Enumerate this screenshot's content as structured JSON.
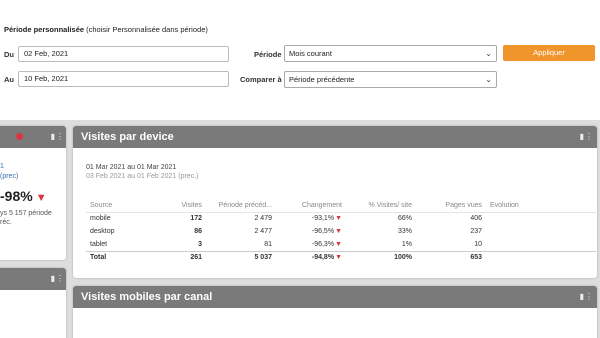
{
  "filter": {
    "title_bold": "Période personnalisée",
    "title_hint": " (choisir Personnalisée dans période)",
    "du_label": "Du",
    "du_value": "02 Feb, 2021",
    "au_label": "Au",
    "au_value": "10 Feb, 2021",
    "periode_label": "Période",
    "periode_value": "Mois courant",
    "comparer_label": "Comparer à",
    "comparer_value": "Période précédente",
    "apply_label": "Appliquer"
  },
  "left_widget": {
    "link1": "1",
    "link2": "(prec)",
    "big_value": "-98%",
    "text1": "ys 5 157 période",
    "text2": "réc."
  },
  "device_widget": {
    "title": "Visites par device",
    "current_period": "01 Mar 2021 au  01 Mar 2021",
    "previous_period": "03 Feb 2021 au  01 Feb 2021 (prec.)",
    "columns": [
      "Source",
      "Visites",
      "Période précéd...",
      "Changement",
      "% Visites/ site",
      "Pages vues",
      "Evolution"
    ],
    "rows": [
      {
        "source": "mobile",
        "visites": "172",
        "prev": "2 479",
        "change": "-93,1%",
        "pct": "66%",
        "pages": "406"
      },
      {
        "source": "desktop",
        "visites": "86",
        "prev": "2 477",
        "change": "-96,5%",
        "pct": "33%",
        "pages": "237"
      },
      {
        "source": "tablet",
        "visites": "3",
        "prev": "81",
        "change": "-96,3%",
        "pct": "1%",
        "pages": "10"
      }
    ],
    "total": {
      "source": "Total",
      "visites": "261",
      "prev": "5 037",
      "change": "-94,8%",
      "pct": "100%",
      "pages": "653"
    }
  },
  "mobile_widget": {
    "title": "Visites mobiles par canal"
  },
  "icons": {
    "comment": "comment-icon",
    "more": "more-vertical-icon",
    "alert": "red-dot-icon",
    "down": "down-triangle-icon"
  },
  "colors": {
    "accent": "#f0942c",
    "header": "#7a7a7a",
    "negative": "#d9343f",
    "link": "#3a6fb0"
  }
}
